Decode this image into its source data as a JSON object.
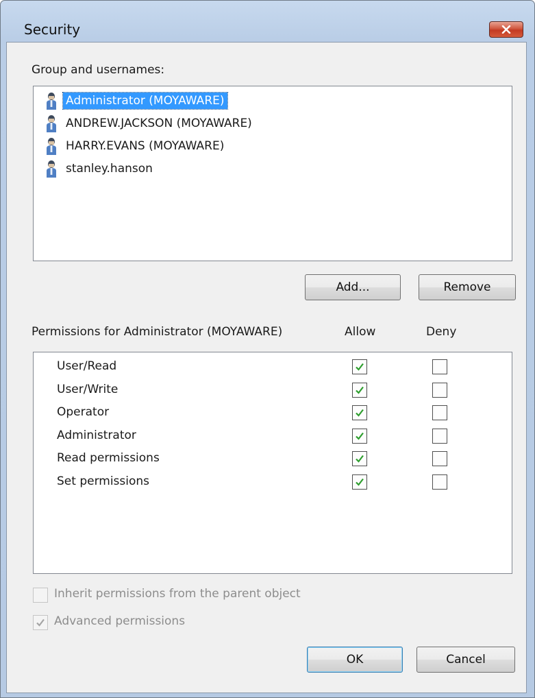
{
  "window": {
    "title": "Security"
  },
  "users_section": {
    "label": "Group and usernames:",
    "users": [
      {
        "name": "Administrator (MOYAWARE)",
        "selected": true
      },
      {
        "name": "ANDREW.JACKSON (MOYAWARE)",
        "selected": false
      },
      {
        "name": "HARRY.EVANS (MOYAWARE)",
        "selected": false
      },
      {
        "name": "stanley.hanson",
        "selected": false
      }
    ],
    "add_label": "Add...",
    "remove_label": "Remove"
  },
  "permissions_section": {
    "label": "Permissions for Administrator (MOYAWARE)",
    "allow_header": "Allow",
    "deny_header": "Deny",
    "permissions": [
      {
        "name": "User/Read",
        "allow": true,
        "deny": false
      },
      {
        "name": "User/Write",
        "allow": true,
        "deny": false
      },
      {
        "name": "Operator",
        "allow": true,
        "deny": false
      },
      {
        "name": "Administrator",
        "allow": true,
        "deny": false
      },
      {
        "name": "Read permissions",
        "allow": true,
        "deny": false
      },
      {
        "name": "Set permissions",
        "allow": true,
        "deny": false
      }
    ]
  },
  "options": {
    "inherit": {
      "label": "Inherit permissions from the parent object",
      "checked": false,
      "enabled": false
    },
    "advanced": {
      "label": "Advanced permissions",
      "checked": true,
      "enabled": false
    }
  },
  "footer": {
    "ok_label": "OK",
    "cancel_label": "Cancel"
  },
  "colors": {
    "selection": "#3399ff",
    "check_green": "#2e9e2e",
    "close_red": "#c33a22"
  },
  "icons": {
    "user": "user-icon",
    "close": "close-icon",
    "check": "checkmark-icon"
  }
}
